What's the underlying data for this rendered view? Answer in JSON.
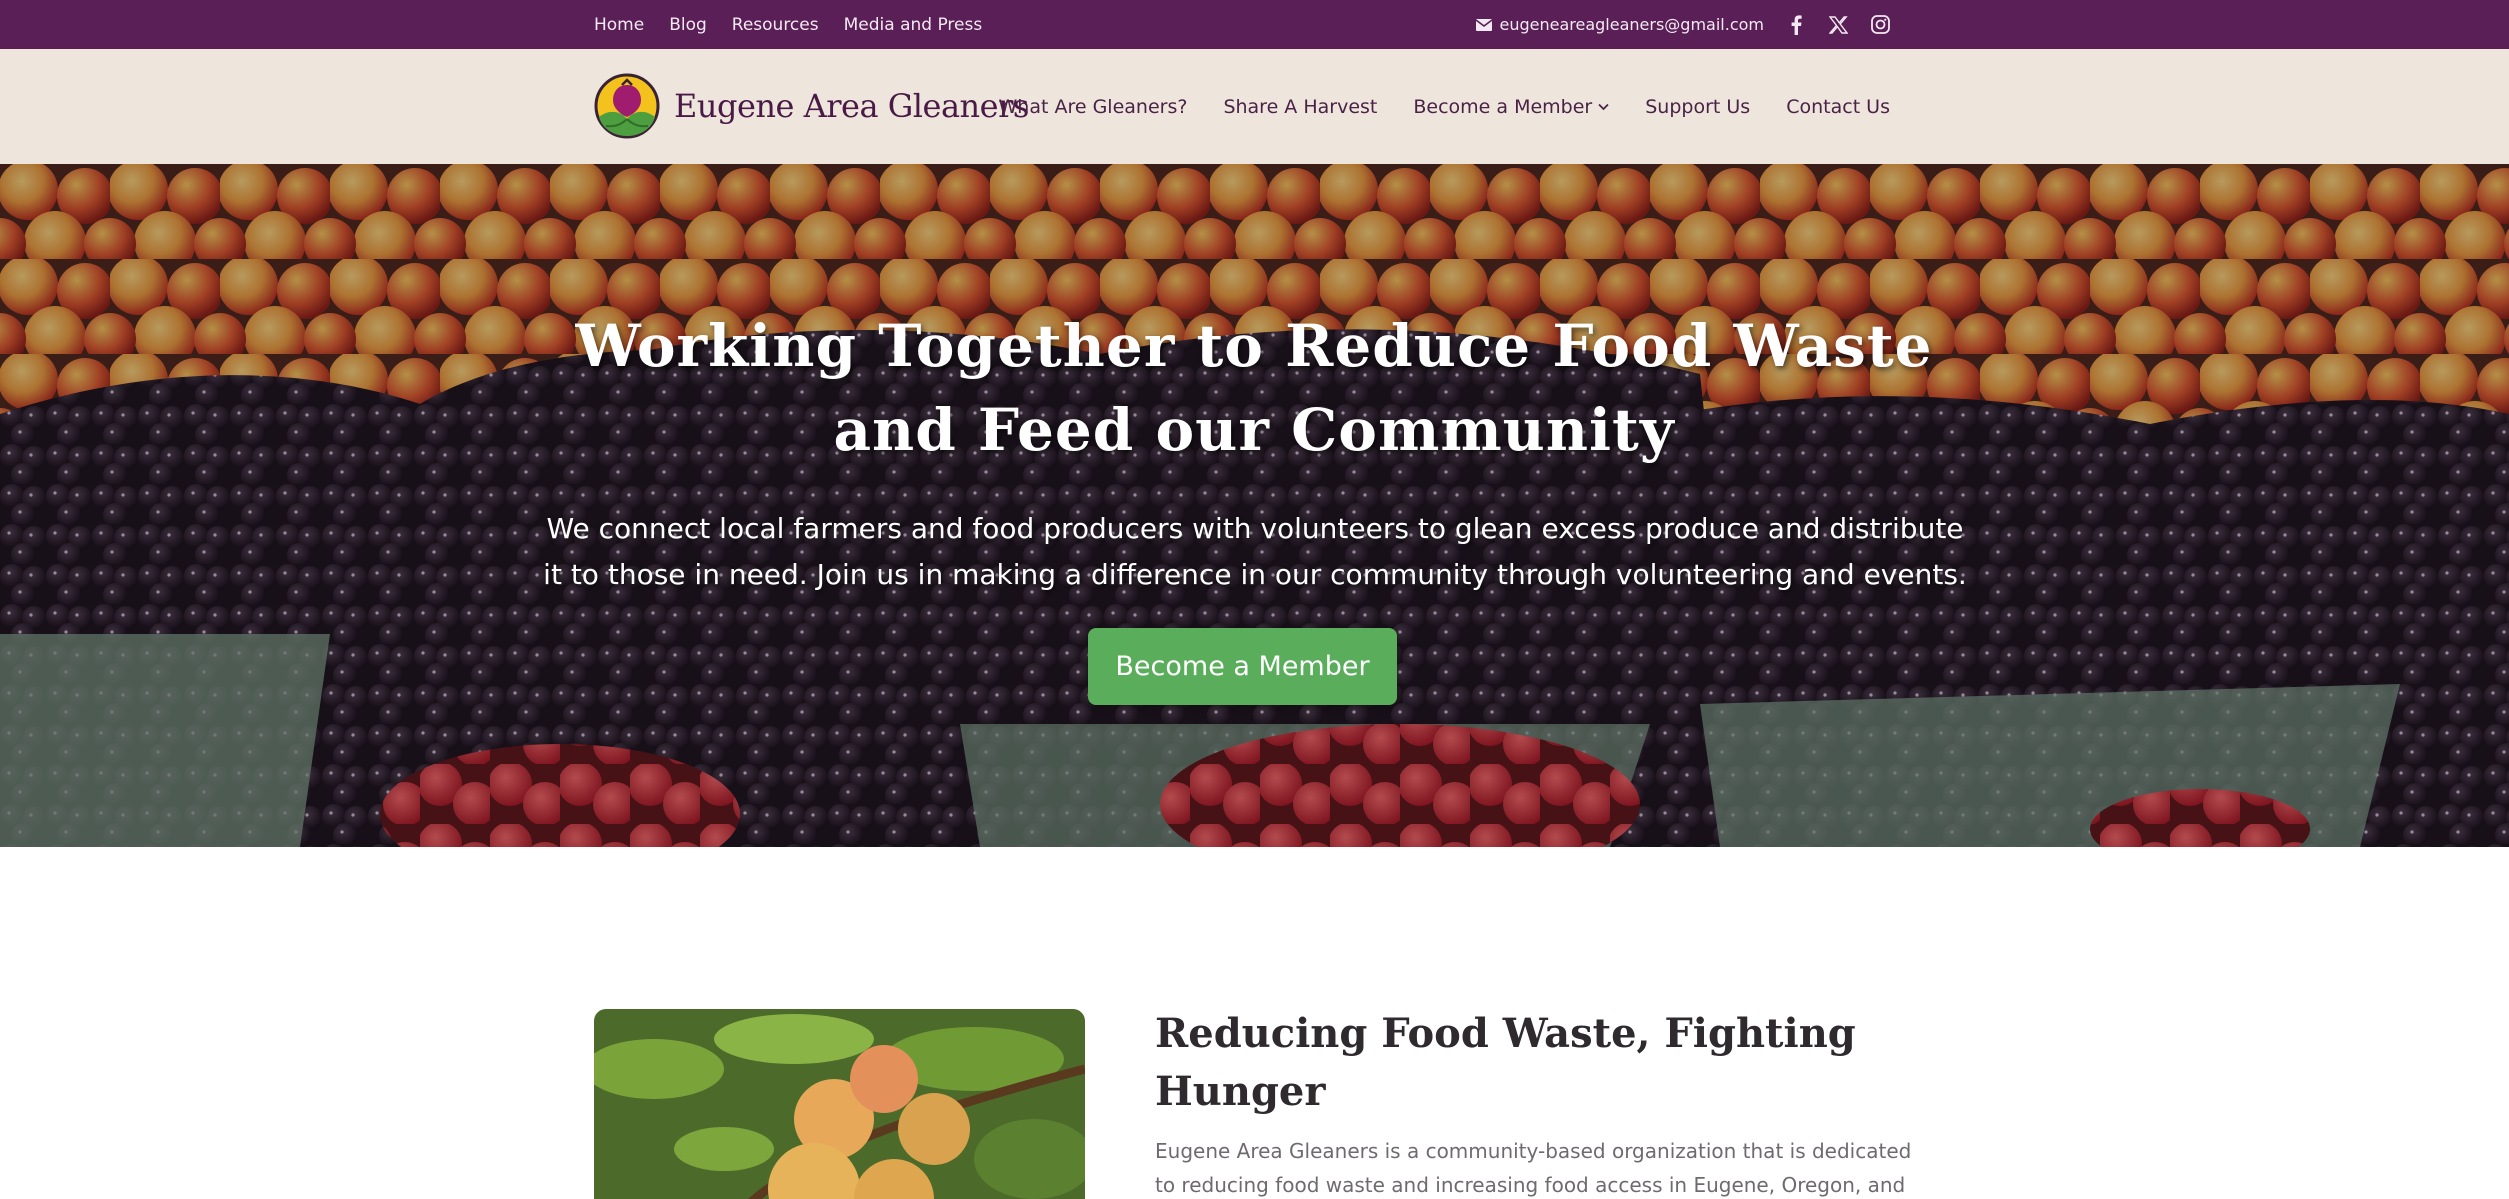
{
  "topbar": {
    "links": [
      "Home",
      "Blog",
      "Resources",
      "Media and Press"
    ],
    "email": "eugeneareagleaners@gmail.com",
    "social": [
      "facebook-icon",
      "x-icon",
      "instagram-icon"
    ]
  },
  "header": {
    "brand_name": "Eugene Area Gleaners",
    "nav": [
      "What Are Gleaners?",
      "Share A Harvest",
      "Become a Member",
      "Support Us",
      "Contact Us"
    ]
  },
  "hero": {
    "title": "Working Together to Reduce Food Waste and Feed our Community",
    "subtitle": "We connect local farmers and food producers with volunteers to glean excess produce and distribute it to those in need. Join us in making a difference in our community through volunteering and events.",
    "button": "Become a Member"
  },
  "section": {
    "title": "Reducing Food Waste, Fighting Hunger",
    "body": "Eugene Area Gleaners is a community-based organization that is dedicated to reducing food waste and increasing food access in Eugene, Oregon, and its"
  },
  "colors": {
    "topbar": "#5a1f56",
    "header": "#eee6dd",
    "button": "#5aae5b",
    "brand": "#4a1a47"
  }
}
